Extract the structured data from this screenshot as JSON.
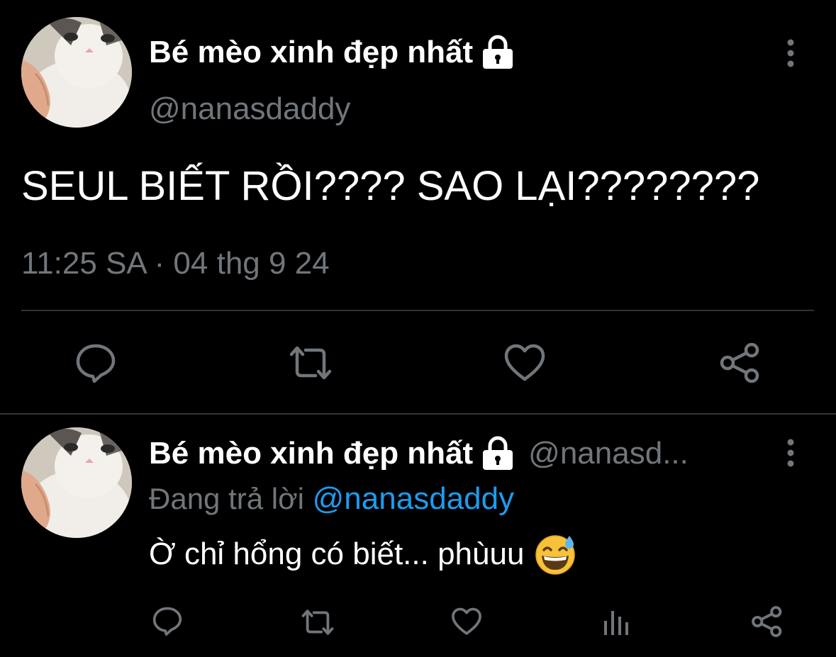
{
  "main_tweet": {
    "display_name": "Bé mèo xinh đẹp nhất",
    "handle": "@nanasdaddy",
    "text": "SEUL BIẾT RỒI???? SAO LẠI????????",
    "timestamp": "11:25 SA · 04 thg 9 24",
    "icons": [
      "more-icon",
      "lock-icon",
      "reply-icon",
      "retweet-icon",
      "like-icon",
      "share-icon"
    ]
  },
  "reply_tweet": {
    "display_name": "Bé mèo xinh đẹp nhất",
    "handle": "@nanasd...",
    "replying_prefix": "Đang trả lời",
    "replying_mention": "@nanasdaddy",
    "text": "Ờ chỉ hổng có biết... phùuu",
    "emoji": "grinning-face-with-sweat",
    "icons": [
      "more-icon",
      "lock-icon",
      "reply-icon",
      "retweet-icon",
      "like-icon",
      "views-icon",
      "share-icon"
    ]
  },
  "colors": {
    "background": "#000000",
    "primary_text": "#ffffff",
    "secondary_text": "#71767b",
    "accent": "#1d9bf0",
    "divider": "#2f3336"
  }
}
